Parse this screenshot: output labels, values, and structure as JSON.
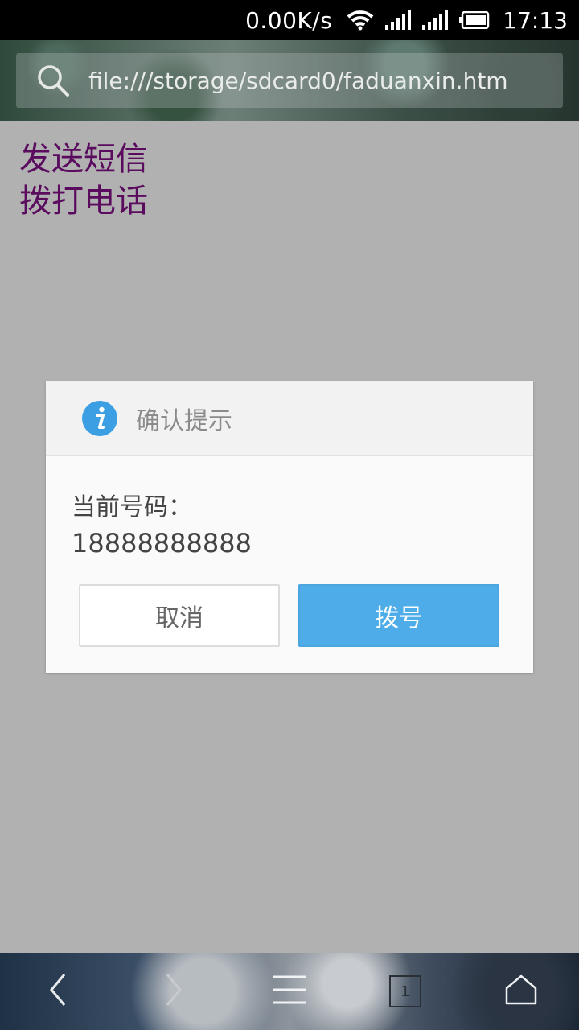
{
  "status_bar": {
    "net_speed": "0.00K/s",
    "time": "17:13",
    "icons": [
      "wifi-icon",
      "signal-icon",
      "signal-icon",
      "battery-icon"
    ]
  },
  "browser": {
    "url": "file:///storage/sdcard0/faduanxin.htm",
    "search_icon": "search-icon"
  },
  "page": {
    "links": [
      "发送短信",
      "拨打电话"
    ]
  },
  "dialog": {
    "title": "确认提示",
    "icon": "info-icon",
    "message": "当前号码：",
    "number": "18888888888",
    "cancel_label": "取消",
    "confirm_label": "拨号",
    "accent_color": "#4eade9"
  },
  "toolbar": {
    "buttons": [
      "back-icon",
      "forward-icon",
      "menu-icon",
      "tabs-icon",
      "home-icon"
    ],
    "tab_count": "1"
  }
}
